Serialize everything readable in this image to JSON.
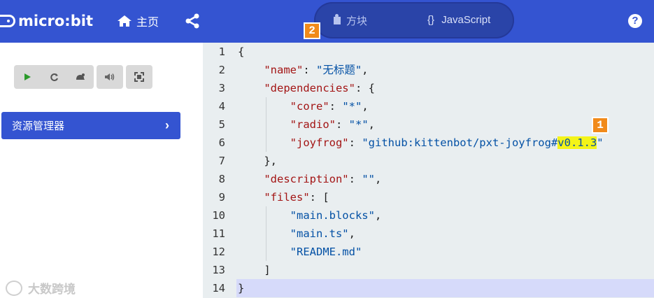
{
  "header": {
    "logo_text": "micro:bit",
    "home_label": "主页",
    "tab_blocks_label": "方块",
    "tab_js_icon": "{}",
    "tab_js_label": "JavaScript",
    "help_label": "?",
    "badge_2": "2",
    "colors": {
      "bar": "#3454d1",
      "toggle": "#2a44a8",
      "badge": "#f18a1a"
    }
  },
  "sidebar": {
    "sim_buttons": [
      "play-icon",
      "restart-icon",
      "slow-motion-icon",
      "mute-icon",
      "fullscreen-icon"
    ],
    "explorer_label": "资源管理器",
    "explorer_chevron": "›",
    "watermark_text": "大数跨境"
  },
  "editor": {
    "badge_1": "1",
    "lines": [
      {
        "n": "1",
        "parts": [
          [
            "p",
            "{"
          ]
        ]
      },
      {
        "n": "2",
        "parts": [
          [
            "p",
            "    "
          ],
          [
            "s",
            "\"name\""
          ],
          [
            "p",
            ": "
          ],
          [
            "v",
            "\"无标题\""
          ],
          [
            "p",
            ","
          ]
        ]
      },
      {
        "n": "3",
        "parts": [
          [
            "p",
            "    "
          ],
          [
            "s",
            "\"dependencies\""
          ],
          [
            "p",
            ": {"
          ]
        ]
      },
      {
        "n": "4",
        "parts": [
          [
            "p",
            "        "
          ],
          [
            "s",
            "\"core\""
          ],
          [
            "p",
            ": "
          ],
          [
            "v",
            "\"*\""
          ],
          [
            "p",
            ","
          ]
        ]
      },
      {
        "n": "5",
        "parts": [
          [
            "p",
            "        "
          ],
          [
            "s",
            "\"radio\""
          ],
          [
            "p",
            ": "
          ],
          [
            "v",
            "\"*\""
          ],
          [
            "p",
            ","
          ]
        ]
      },
      {
        "n": "6",
        "parts": [
          [
            "p",
            "        "
          ],
          [
            "s",
            "\"joyfrog\""
          ],
          [
            "p",
            ": "
          ],
          [
            "v",
            "\"github:kittenbot/pxt-joyfrog#"
          ],
          [
            "h",
            "v0.1.3"
          ],
          [
            "v",
            "\""
          ]
        ]
      },
      {
        "n": "7",
        "parts": [
          [
            "p",
            "    },"
          ]
        ]
      },
      {
        "n": "8",
        "parts": [
          [
            "p",
            "    "
          ],
          [
            "s",
            "\"description\""
          ],
          [
            "p",
            ": "
          ],
          [
            "v",
            "\"\""
          ],
          [
            "p",
            ","
          ]
        ]
      },
      {
        "n": "9",
        "parts": [
          [
            "p",
            "    "
          ],
          [
            "s",
            "\"files\""
          ],
          [
            "p",
            ": ["
          ]
        ]
      },
      {
        "n": "10",
        "parts": [
          [
            "p",
            "        "
          ],
          [
            "v",
            "\"main.blocks\""
          ],
          [
            "p",
            ","
          ]
        ]
      },
      {
        "n": "11",
        "parts": [
          [
            "p",
            "        "
          ],
          [
            "v",
            "\"main.ts\""
          ],
          [
            "p",
            ","
          ]
        ]
      },
      {
        "n": "12",
        "parts": [
          [
            "p",
            "        "
          ],
          [
            "v",
            "\"README.md\""
          ]
        ]
      },
      {
        "n": "13",
        "parts": [
          [
            "p",
            "    ]"
          ]
        ]
      },
      {
        "n": "14",
        "parts": [
          [
            "p",
            "}"
          ]
        ]
      }
    ]
  }
}
